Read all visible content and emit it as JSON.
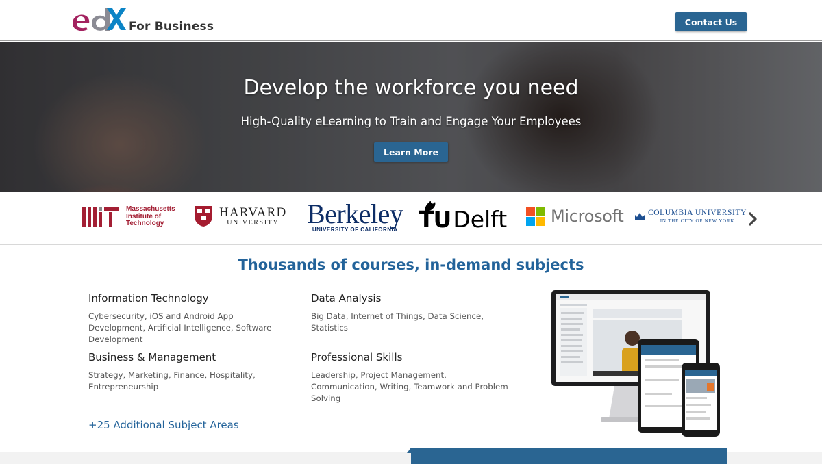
{
  "header": {
    "brand_logo": "edX",
    "brand_sub": "For Business",
    "contact_label": "Contact Us"
  },
  "hero": {
    "title": "Develop the workforce you need",
    "subtitle": "High-Quality eLearning to Train and Engage Your Employees",
    "cta_label": "Learn More"
  },
  "partners": {
    "mit_mark": "MIT",
    "mit_name_1": "Massachusetts",
    "mit_name_2": "Institute of",
    "mit_name_3": "Technology",
    "harvard_name": "HARVARD",
    "harvard_sub": "UNIVERSITY",
    "berkeley_name": "Berkeley",
    "berkeley_sub": "UNIVERSITY OF CALIFORNIA",
    "tudelft_a": "TU",
    "tudelft_b": "Delft",
    "microsoft_name": "Microsoft",
    "columbia_name": "COLUMBIA UNIVERSITY",
    "columbia_sub": "IN THE CITY OF NEW YORK",
    "next_icon": "chevron-right-icon"
  },
  "courses": {
    "title": "Thousands of courses, in-demand subjects",
    "subjects": [
      {
        "name": "Information Technology",
        "topics": "Cybersecurity, iOS and Android App Development, Artificial Intelligence, Software Development"
      },
      {
        "name": "Data Analysis",
        "topics": "Big Data, Internet of Things, Data Science, Statistics"
      },
      {
        "name": "Business & Management",
        "topics": "Strategy, Marketing, Finance, Hospitality, Entrepreneurship"
      },
      {
        "name": "Professional Skills",
        "topics": "Leadership, Project Management, Communication, Writing, Teamwork and Problem Solving"
      }
    ],
    "more_link": "+25 Additional Subject Areas"
  },
  "colors": {
    "primary": "#2a6592",
    "link": "#23639a",
    "edx_magenta": "#a3225f",
    "edx_blue": "#0b84c6",
    "mit_red": "#a31f34",
    "berkeley_blue": "#0d2d66",
    "ms_red": "#f25022",
    "ms_green": "#7fba00",
    "ms_blue": "#00a4ef",
    "ms_yellow": "#ffb900"
  }
}
